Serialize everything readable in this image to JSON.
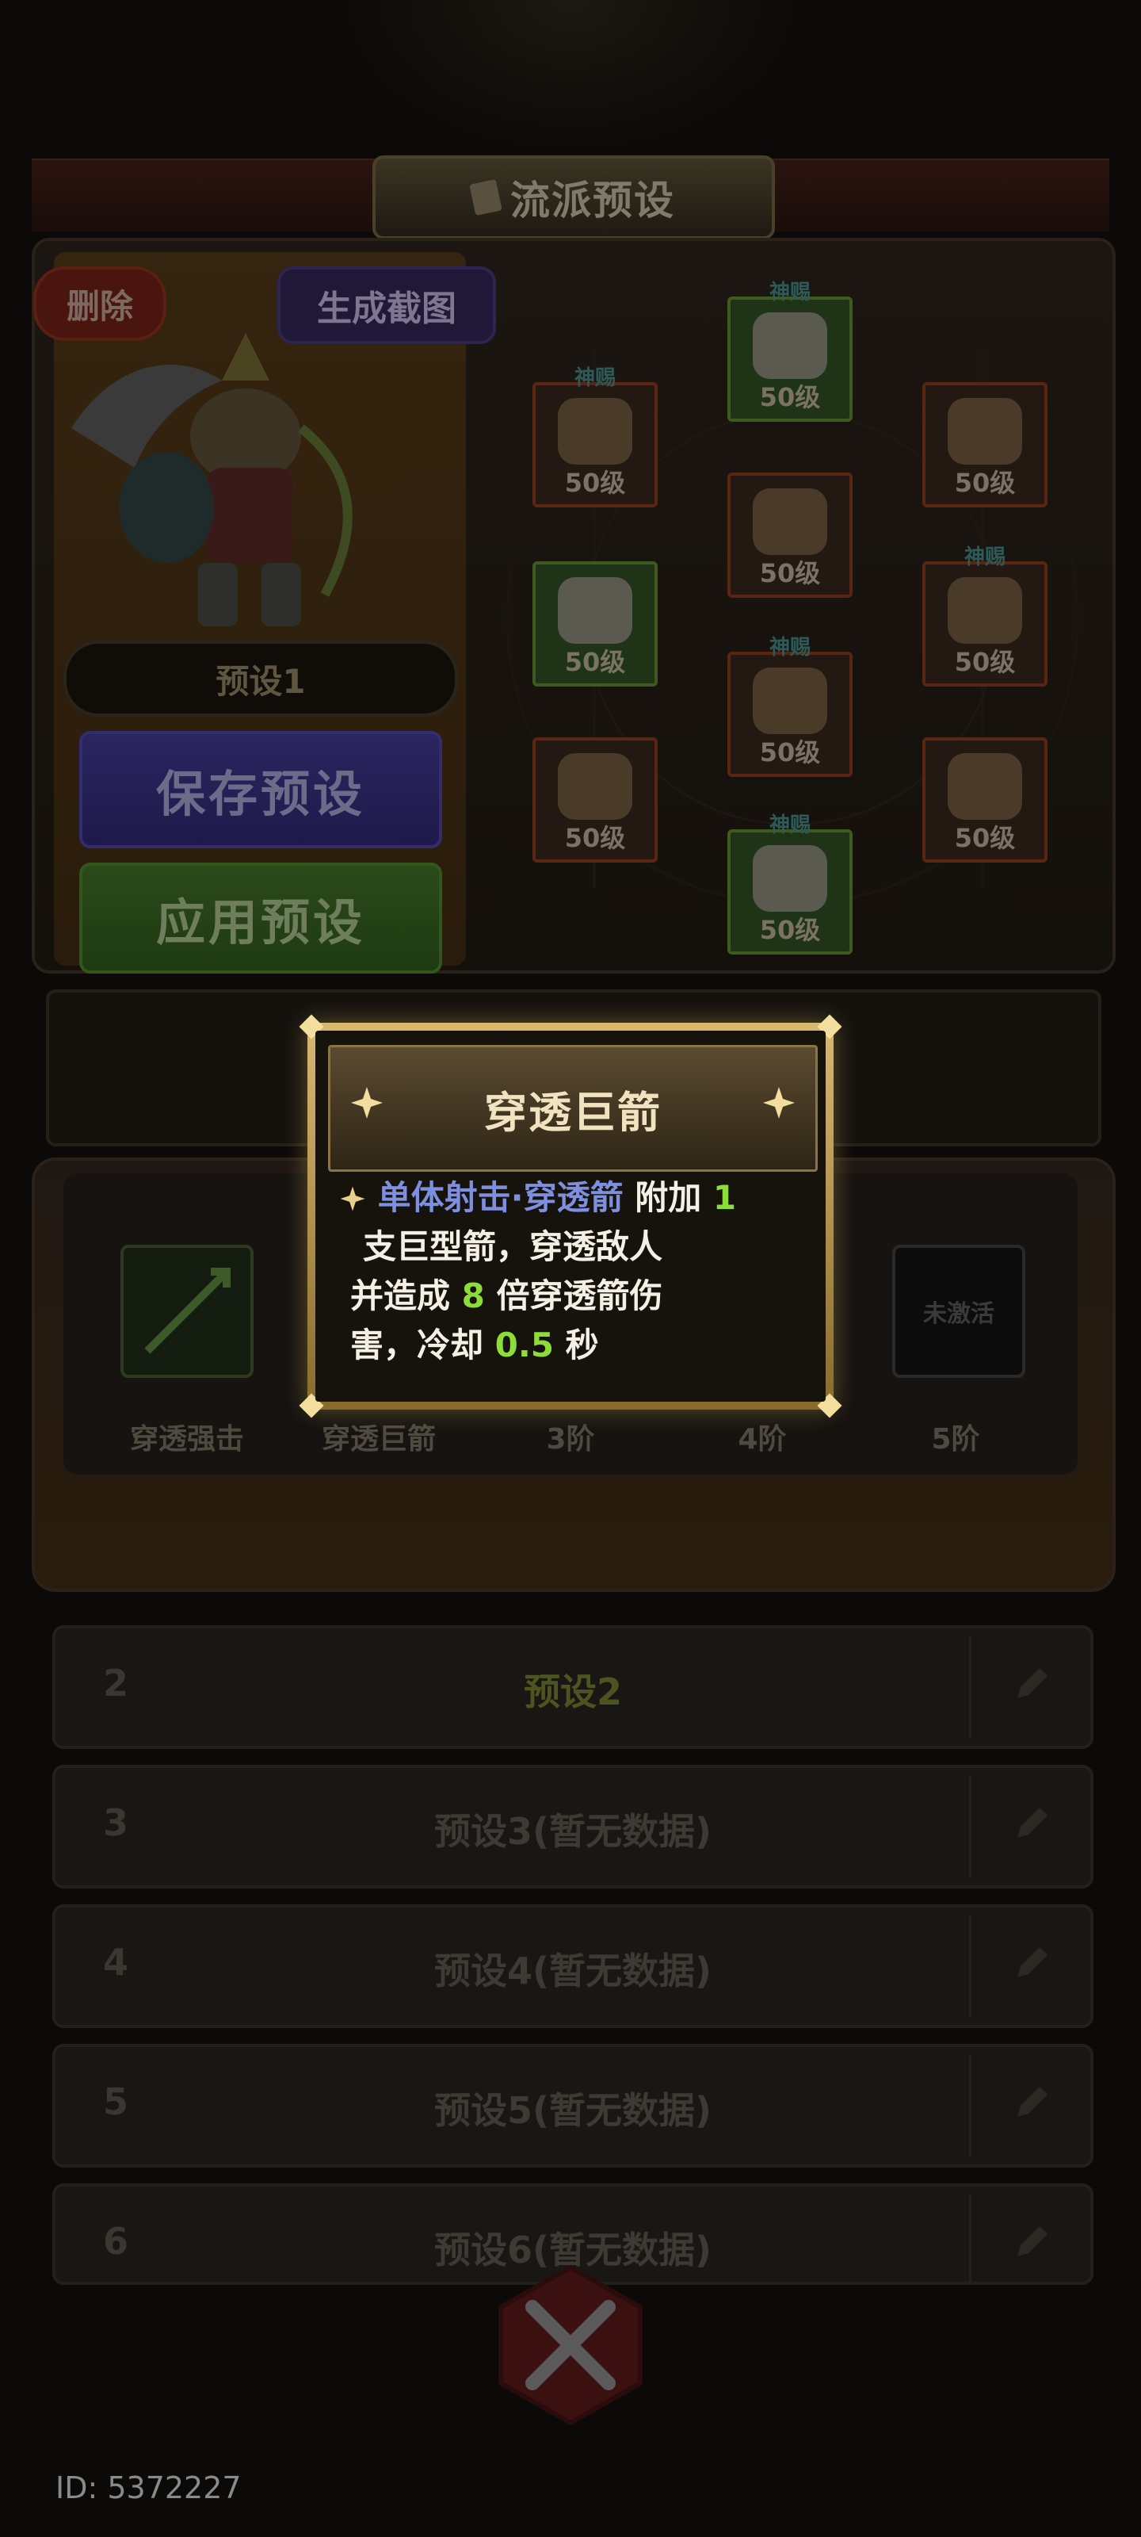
{
  "header": {
    "title": "流派预设"
  },
  "preset_card": {
    "delete_label": "删除",
    "screenshot_label": "生成截图",
    "preset_name": "预设1",
    "save_label": "保存预设",
    "apply_label": "应用预设"
  },
  "equipment": [
    {
      "slot": "weapon-top",
      "tag": "神赐",
      "level": "50级"
    },
    {
      "slot": "helmet-left",
      "tag": "神赐",
      "level": "50级"
    },
    {
      "slot": "wings-right",
      "tag": "",
      "level": "50级"
    },
    {
      "slot": "armor-center",
      "tag": "",
      "level": "50级"
    },
    {
      "slot": "gloves-left",
      "tag": "",
      "level": "50级"
    },
    {
      "slot": "belt-right",
      "tag": "神赐",
      "level": "50级"
    },
    {
      "slot": "pants-center",
      "tag": "神赐",
      "level": "50级"
    },
    {
      "slot": "bow-left",
      "tag": "",
      "level": "50级"
    },
    {
      "slot": "quiver-right",
      "tag": "",
      "level": "50级"
    },
    {
      "slot": "boots-bottom",
      "tag": "神赐",
      "level": "50级"
    }
  ],
  "skills": [
    {
      "label": "穿透强击",
      "unlocked": true
    },
    {
      "label": "穿透巨箭",
      "unlocked": true
    },
    {
      "label": "3阶",
      "unlocked": false
    },
    {
      "label": "4阶",
      "unlocked": false
    },
    {
      "label": "5阶",
      "unlocked": false,
      "badge": "未激活"
    }
  ],
  "preset_list": [
    {
      "index": "2",
      "name": "预设2"
    },
    {
      "index": "3",
      "name": "预设3(暂无数据)"
    },
    {
      "index": "4",
      "name": "预设4(暂无数据)"
    },
    {
      "index": "5",
      "name": "预设5(暂无数据)"
    },
    {
      "index": "6",
      "name": "预设6(暂无数据)"
    }
  ],
  "popup": {
    "title": "穿透巨箭",
    "keyword": "单体射击·穿透箭",
    "t1": " 附加 ",
    "n1": "1",
    "line2": "支巨型箭，穿透敌人",
    "t3a": "并造成 ",
    "n2": "8",
    "t3b": " 倍穿透箭伤",
    "t4a": "害，冷却 ",
    "n3": "0.5",
    "t4b": " 秒"
  },
  "footer": {
    "id_text": "ID: 5372227"
  },
  "colors": {
    "keyword": "#7f8fe0",
    "number": "#8edc3a",
    "popup_border": "#d9b870"
  },
  "icons": [
    "book-icon",
    "edit-pencil-icon",
    "sparkle-icon",
    "close-x-icon",
    "arrow-icon"
  ]
}
